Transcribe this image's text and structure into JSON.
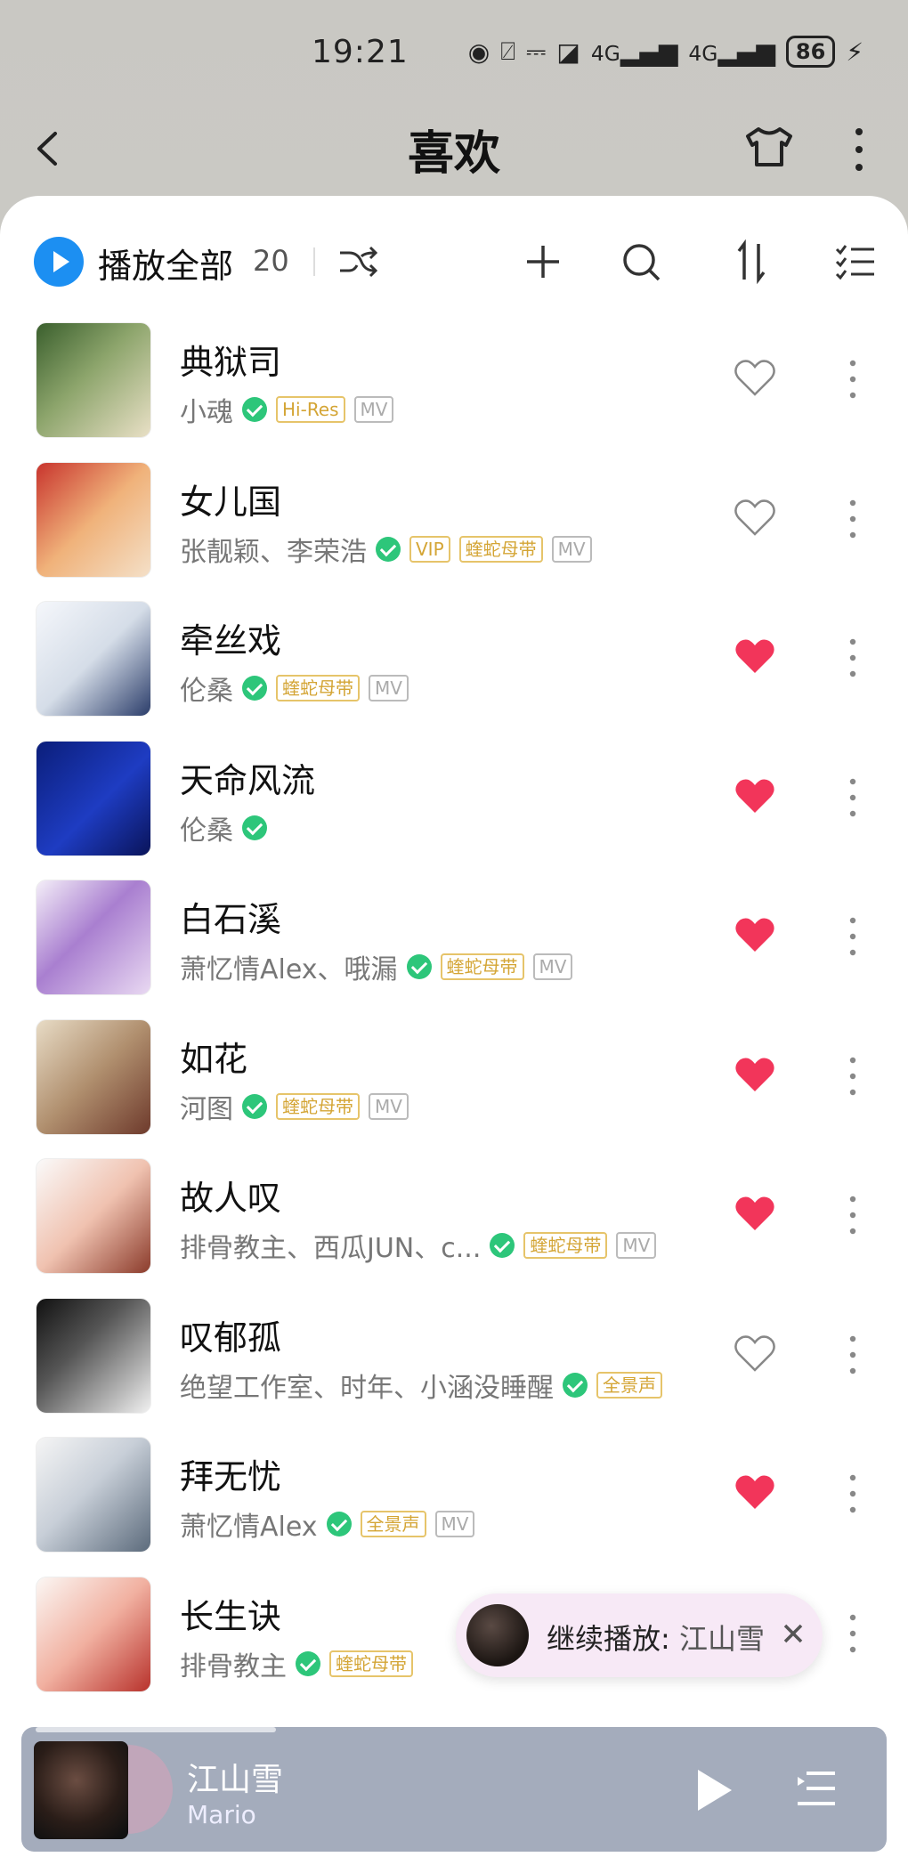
{
  "status_bar": {
    "time": "19:21",
    "battery": "86",
    "signal_1": "4G",
    "signal_2": "4G"
  },
  "header": {
    "title": "喜欢"
  },
  "toolbar": {
    "play_all_label": "播放全部",
    "count": "20"
  },
  "songs": [
    {
      "title": "典狱司",
      "artist": "小魂",
      "tags": [
        "Hi-Res",
        "MV"
      ],
      "liked": false
    },
    {
      "title": "女儿国",
      "artist": "张靓颖、李荣浩",
      "tags": [
        "VIP",
        "蝰蛇母带",
        "MV"
      ],
      "liked": false
    },
    {
      "title": "牵丝戏",
      "artist": "伦桑",
      "tags": [
        "蝰蛇母带",
        "MV"
      ],
      "liked": true
    },
    {
      "title": "天命风流",
      "artist": "伦桑",
      "tags": [],
      "liked": true
    },
    {
      "title": "白石溪",
      "artist": "萧忆情Alex、哦漏",
      "tags": [
        "蝰蛇母带",
        "MV"
      ],
      "liked": true
    },
    {
      "title": "如花",
      "artist": "河图",
      "tags": [
        "蝰蛇母带",
        "MV"
      ],
      "liked": true
    },
    {
      "title": "故人叹",
      "artist": "排骨教主、西瓜JUN、c...",
      "tags": [
        "蝰蛇母带",
        "MV"
      ],
      "liked": true
    },
    {
      "title": "叹郁孤",
      "artist": "绝望工作室、时年、小涵没睡醒",
      "tags": [
        "全景声"
      ],
      "liked": false
    },
    {
      "title": "拜无忧",
      "artist": "萧忆情Alex",
      "tags": [
        "全景声",
        "MV"
      ],
      "liked": true
    },
    {
      "title": "长生诀",
      "artist": "排骨教主",
      "tags": [
        "蝰蛇母带"
      ],
      "liked": false
    }
  ],
  "resume": {
    "label": "继续播放:",
    "song": "江山雪"
  },
  "player": {
    "title": "江山雪",
    "artist": "Mario"
  },
  "colors": {
    "accent": "#1c8ff2",
    "heart": "#f2355a",
    "verified": "#2dc67a",
    "tag_gold": "#d4a535"
  }
}
